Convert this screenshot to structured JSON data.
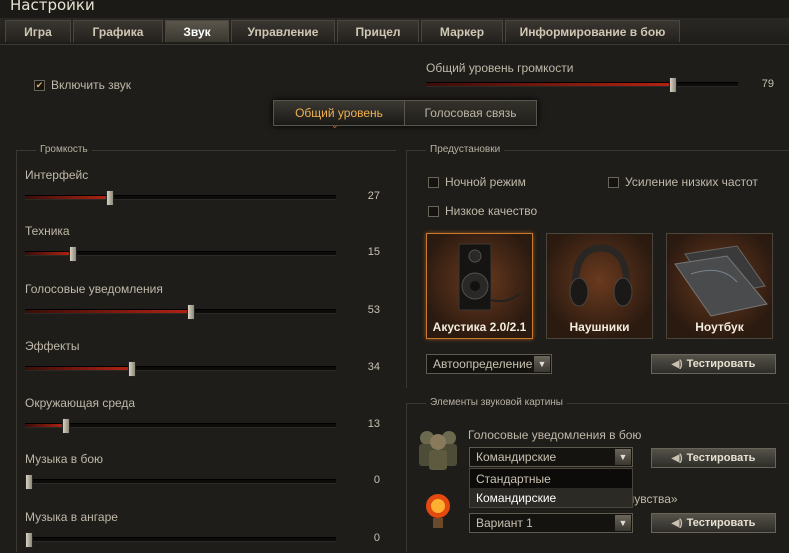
{
  "window": {
    "title": "Настройки"
  },
  "tabs": [
    {
      "label": "Игра"
    },
    {
      "label": "Графика"
    },
    {
      "label": "Звук"
    },
    {
      "label": "Управление"
    },
    {
      "label": "Прицел"
    },
    {
      "label": "Маркер"
    },
    {
      "label": "Информирование в бою"
    }
  ],
  "active_tab": "Звук",
  "enable_sound": {
    "label": "Включить звук",
    "checked": true
  },
  "master_volume": {
    "label": "Общий уровень громкости",
    "value": 79
  },
  "mode_switch": {
    "options": [
      "Общий уровень",
      "Голосовая связь"
    ],
    "selected": "Общий уровень"
  },
  "volume_panel": {
    "title": "Громкость",
    "sliders": [
      {
        "label": "Интерфейс",
        "value": 27
      },
      {
        "label": "Техника",
        "value": 15
      },
      {
        "label": "Голосовые уведомления",
        "value": 53
      },
      {
        "label": "Эффекты",
        "value": 34
      },
      {
        "label": "Окружающая среда",
        "value": 13
      },
      {
        "label": "Музыка в бою",
        "value": 0
      },
      {
        "label": "Музыка в ангаре",
        "value": 0
      }
    ]
  },
  "presets": {
    "title": "Предустановки",
    "night_mode": {
      "label": "Ночной режим",
      "checked": false
    },
    "bass_boost": {
      "label": "Усиление низких частот",
      "checked": false
    },
    "low_quality": {
      "label": "Низкое качество",
      "checked": false
    },
    "devices": [
      {
        "label": "Акустика 2.0/2.1",
        "selected": true,
        "icon": "speaker-icon"
      },
      {
        "label": "Наушники",
        "selected": false,
        "icon": "headphones-icon"
      },
      {
        "label": "Ноутбук",
        "selected": false,
        "icon": "laptop-icon"
      }
    ],
    "auto_detect": {
      "value": "Автоопределение"
    },
    "test_button": "Тестировать"
  },
  "sound_elements": {
    "title": "Элементы звуковой картины",
    "voice_notifications": {
      "label": "Голосовые уведомления в бою",
      "selected": "Командирские",
      "options": [
        "Стандартные",
        "Командирские"
      ],
      "test_button": "Тестировать"
    },
    "sixth_sense": {
      "label_visible_part": "чувства»",
      "selected": "Вариант 1",
      "test_button": "Тестировать"
    }
  },
  "colors": {
    "accent": "#b32312",
    "highlight": "#c67b2a",
    "text": "#c9c2b2"
  }
}
